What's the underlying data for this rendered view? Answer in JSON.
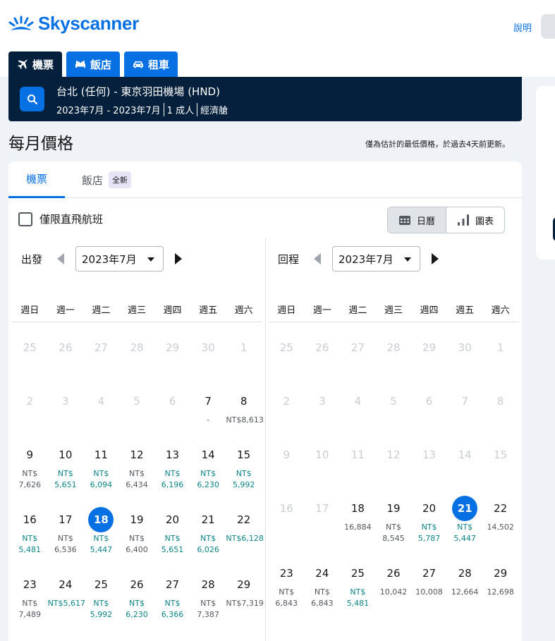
{
  "header": {
    "logo_text": "Skyscanner",
    "help_link": "說明"
  },
  "tabs": [
    {
      "label": "機票",
      "icon": "plane-icon",
      "active": true
    },
    {
      "label": "飯店",
      "icon": "bed-icon",
      "active": false
    },
    {
      "label": "租車",
      "icon": "car-icon",
      "active": false
    }
  ],
  "search": {
    "route": "台北 (任何) - 東京羽田機場 (HND)",
    "dates": "2023年7月 - 2023年7月",
    "travellers": "1 成人",
    "cabin": "經濟艙"
  },
  "section": {
    "title": "每月價格",
    "note": "僅為估計的最低價格，於過去4天前更新。"
  },
  "card_tabs": {
    "flights": "機票",
    "hotels": "飯店",
    "new_badge": "全新"
  },
  "filters": {
    "direct_only": "僅限直飛航班"
  },
  "view_toggle": {
    "calendar": "日曆",
    "chart": "圖表"
  },
  "weekdays": [
    "週日",
    "週一",
    "週二",
    "週三",
    "週四",
    "週五",
    "週六"
  ],
  "departure": {
    "label": "出發",
    "month": "2023年7月",
    "rows": [
      [
        {
          "d": "25",
          "m": true
        },
        {
          "d": "26",
          "m": true
        },
        {
          "d": "27",
          "m": true
        },
        {
          "d": "28",
          "m": true
        },
        {
          "d": "29",
          "m": true
        },
        {
          "d": "30",
          "m": true
        },
        {
          "d": "1",
          "m": true
        }
      ],
      [
        {
          "d": "2",
          "m": true
        },
        {
          "d": "3",
          "m": true
        },
        {
          "d": "4",
          "m": true
        },
        {
          "d": "5",
          "m": true
        },
        {
          "d": "6",
          "m": true
        },
        {
          "d": "7",
          "p": [
            "-"
          ],
          "t": "none"
        },
        {
          "d": "8",
          "p": [
            "NT$8,613"
          ],
          "t": "normal"
        }
      ],
      [
        {
          "d": "9",
          "p": [
            "NT$",
            "7,626"
          ],
          "t": "normal"
        },
        {
          "d": "10",
          "p": [
            "NT$",
            "5,651"
          ],
          "t": "cheap"
        },
        {
          "d": "11",
          "p": [
            "NT$",
            "6,094"
          ],
          "t": "cheap"
        },
        {
          "d": "12",
          "p": [
            "NT$",
            "6,434"
          ],
          "t": "normal"
        },
        {
          "d": "13",
          "p": [
            "NT$",
            "6,196"
          ],
          "t": "cheap"
        },
        {
          "d": "14",
          "p": [
            "NT$",
            "6,230"
          ],
          "t": "cheap"
        },
        {
          "d": "15",
          "p": [
            "NT$",
            "5,992"
          ],
          "t": "cheap"
        }
      ],
      [
        {
          "d": "16",
          "p": [
            "NT$",
            "5,481"
          ],
          "t": "cheap"
        },
        {
          "d": "17",
          "p": [
            "NT$",
            "6,536"
          ],
          "t": "normal"
        },
        {
          "d": "18",
          "p": [
            "NT$",
            "5,447"
          ],
          "t": "cheap",
          "sel": true
        },
        {
          "d": "19",
          "p": [
            "NT$",
            "6,400"
          ],
          "t": "normal"
        },
        {
          "d": "20",
          "p": [
            "NT$",
            "5,651"
          ],
          "t": "cheap"
        },
        {
          "d": "21",
          "p": [
            "NT$",
            "6,026"
          ],
          "t": "cheap"
        },
        {
          "d": "22",
          "p": [
            "NT$6,128"
          ],
          "t": "cheap"
        }
      ],
      [
        {
          "d": "23",
          "p": [
            "NT$",
            "7,489"
          ],
          "t": "normal"
        },
        {
          "d": "24",
          "p": [
            "NT$5,617"
          ],
          "t": "cheap"
        },
        {
          "d": "25",
          "p": [
            "NT$",
            "5,992"
          ],
          "t": "cheap"
        },
        {
          "d": "26",
          "p": [
            "NT$",
            "6,230"
          ],
          "t": "cheap"
        },
        {
          "d": "27",
          "p": [
            "NT$",
            "6,366"
          ],
          "t": "cheap"
        },
        {
          "d": "28",
          "p": [
            "NT$",
            "7,387"
          ],
          "t": "normal"
        },
        {
          "d": "29",
          "p": [
            "NT$7,319"
          ],
          "t": "normal"
        }
      ]
    ]
  },
  "return": {
    "label": "回程",
    "month": "2023年7月",
    "rows": [
      [
        {
          "d": "25",
          "m": true
        },
        {
          "d": "26",
          "m": true
        },
        {
          "d": "27",
          "m": true
        },
        {
          "d": "28",
          "m": true
        },
        {
          "d": "29",
          "m": true
        },
        {
          "d": "30",
          "m": true
        },
        {
          "d": "1",
          "m": true
        }
      ],
      [
        {
          "d": "2",
          "m": true
        },
        {
          "d": "3",
          "m": true
        },
        {
          "d": "4",
          "m": true
        },
        {
          "d": "5",
          "m": true
        },
        {
          "d": "6",
          "m": true
        },
        {
          "d": "7",
          "m": true
        },
        {
          "d": "8",
          "m": true
        }
      ],
      [
        {
          "d": "9",
          "m": true
        },
        {
          "d": "10",
          "m": true
        },
        {
          "d": "11",
          "m": true
        },
        {
          "d": "12",
          "m": true
        },
        {
          "d": "13",
          "m": true
        },
        {
          "d": "14",
          "m": true
        },
        {
          "d": "15",
          "m": true
        }
      ],
      [
        {
          "d": "16",
          "m": true
        },
        {
          "d": "17",
          "m": true
        },
        {
          "d": "18",
          "p": [
            "16,884"
          ],
          "t": "normal"
        },
        {
          "d": "19",
          "p": [
            "NT$",
            "8,545"
          ],
          "t": "normal"
        },
        {
          "d": "20",
          "p": [
            "NT$",
            "5,787"
          ],
          "t": "cheap"
        },
        {
          "d": "21",
          "p": [
            "NT$",
            "5,447"
          ],
          "t": "cheap",
          "sel": true
        },
        {
          "d": "22",
          "p": [
            "14,502"
          ],
          "t": "normal"
        }
      ],
      [
        {
          "d": "23",
          "p": [
            "NT$",
            "6,843"
          ],
          "t": "normal"
        },
        {
          "d": "24",
          "p": [
            "NT$",
            "6,843"
          ],
          "t": "normal"
        },
        {
          "d": "25",
          "p": [
            "NT$",
            "5,481"
          ],
          "t": "cheap"
        },
        {
          "d": "26",
          "p": [
            "10,042"
          ],
          "t": "normal"
        },
        {
          "d": "27",
          "p": [
            "10,008"
          ],
          "t": "normal"
        },
        {
          "d": "28",
          "p": [
            "12,664"
          ],
          "t": "normal"
        },
        {
          "d": "29",
          "p": [
            "12,698"
          ],
          "t": "normal"
        }
      ]
    ]
  },
  "colors": {
    "brand_blue": "#0770e3",
    "navy": "#05203c",
    "cheap_price": "#0c838a",
    "normal_price": "#545860",
    "muted_day": "#c9cdd3"
  }
}
